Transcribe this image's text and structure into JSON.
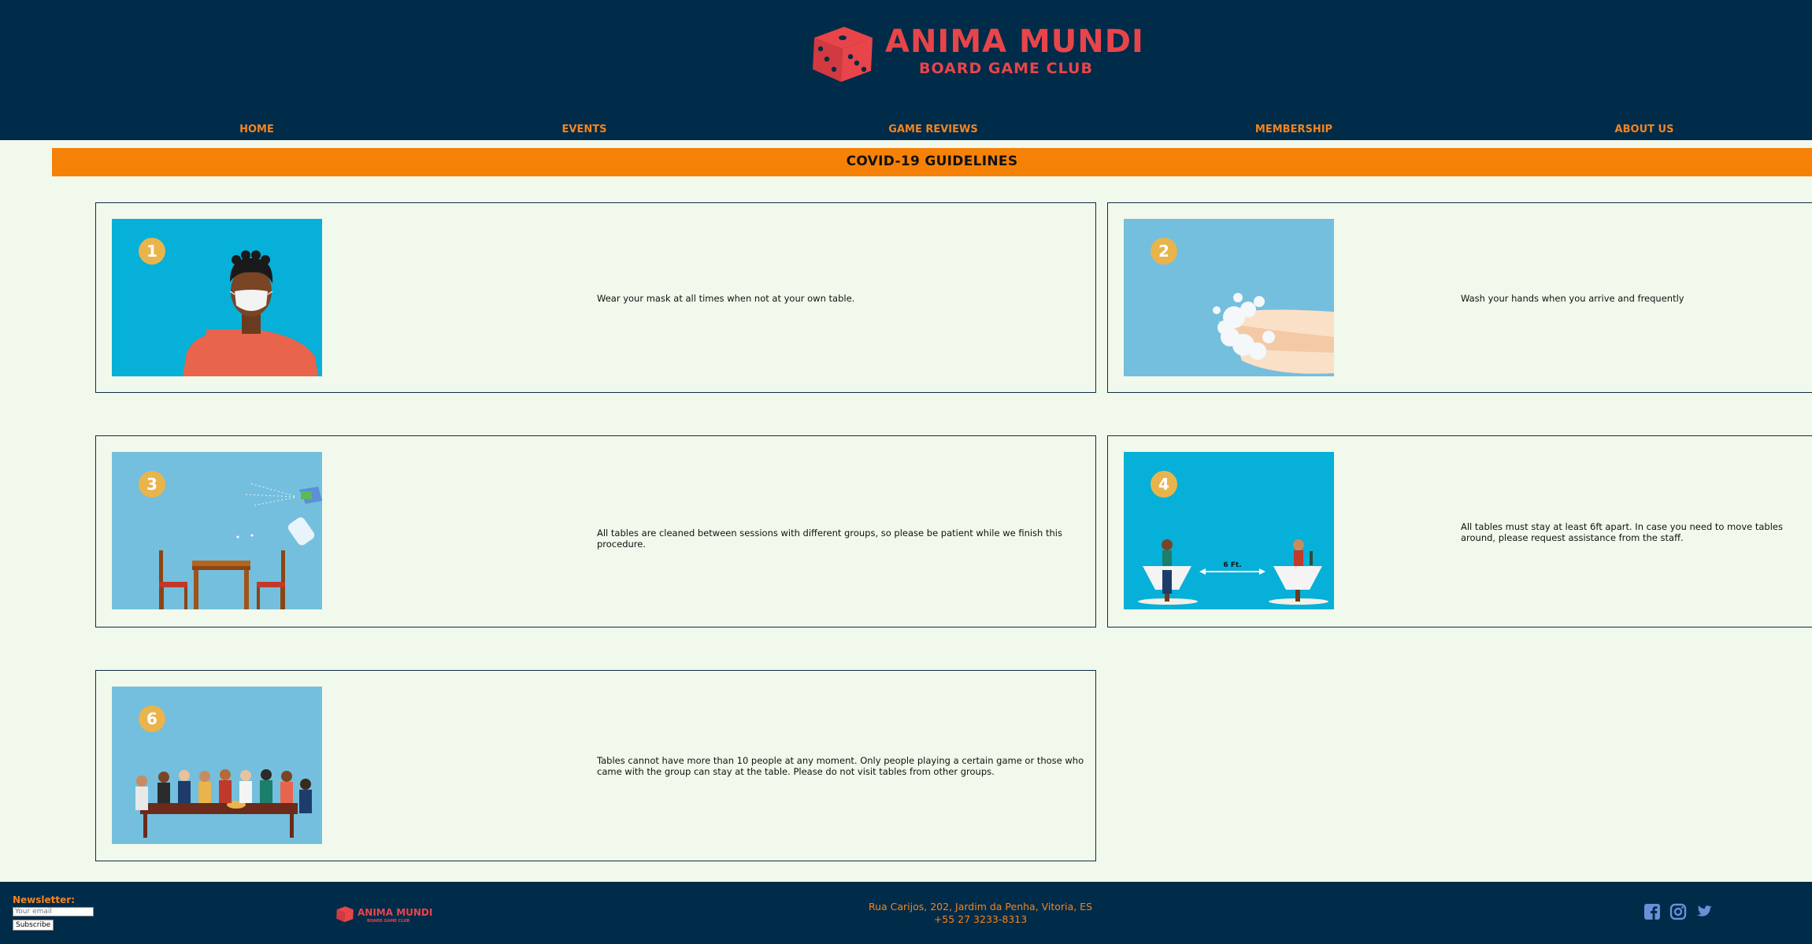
{
  "brand": {
    "name": "ANIMA MUNDI",
    "tagline": "BOARD GAME CLUB",
    "color": "#e8454a"
  },
  "nav": {
    "items": [
      {
        "label": "HOME"
      },
      {
        "label": "EVENTS"
      },
      {
        "label": "GAME REVIEWS"
      },
      {
        "label": "MEMBERSHIP"
      },
      {
        "label": "ABOUT US"
      }
    ]
  },
  "banner": {
    "title": "COVID-19 GUIDELINES"
  },
  "guidelines": [
    {
      "number": "1",
      "icon": "person-wearing-mask",
      "text": "Wear your mask at all times when not at your own table."
    },
    {
      "number": "2",
      "icon": "washing-hands",
      "text": "Wash your hands when you arrive and frequently"
    },
    {
      "number": "3",
      "icon": "sanitizing-table",
      "text": "All tables are cleaned between sessions with different groups, so please be patient while we finish this procedure."
    },
    {
      "number": "4",
      "icon": "distanced-tables",
      "text": "All tables must stay at least 6ft apart. In case you need to move tables around, please request assistance from the staff.",
      "distance_label": "6 Ft."
    },
    {
      "number": "6",
      "icon": "group-at-table",
      "text": "Tables cannot have more than 10 people at any moment. Only people playing a certain game or those who came with the group can stay at the table. Please do not visit tables from other groups."
    }
  ],
  "footer": {
    "newsletter_label": "Newsletter:",
    "email_placeholder": "Your email",
    "subscribe_label": "Subscribe",
    "logo_name": "ANIMA MUNDI",
    "logo_tagline": "BOARD GAME CLUB",
    "address": "Rua Carijos, 202, Jardim da Penha, Vitoria, ES",
    "phone": "+55 27 3233-8313",
    "social": [
      "facebook-icon",
      "instagram-icon",
      "twitter-icon"
    ]
  },
  "colors": {
    "header_bg": "#002b49",
    "page_bg": "#f1f9ec",
    "accent_orange": "#f68107",
    "nav_text": "#f4851f",
    "social_icons": "#6b8fd6"
  }
}
